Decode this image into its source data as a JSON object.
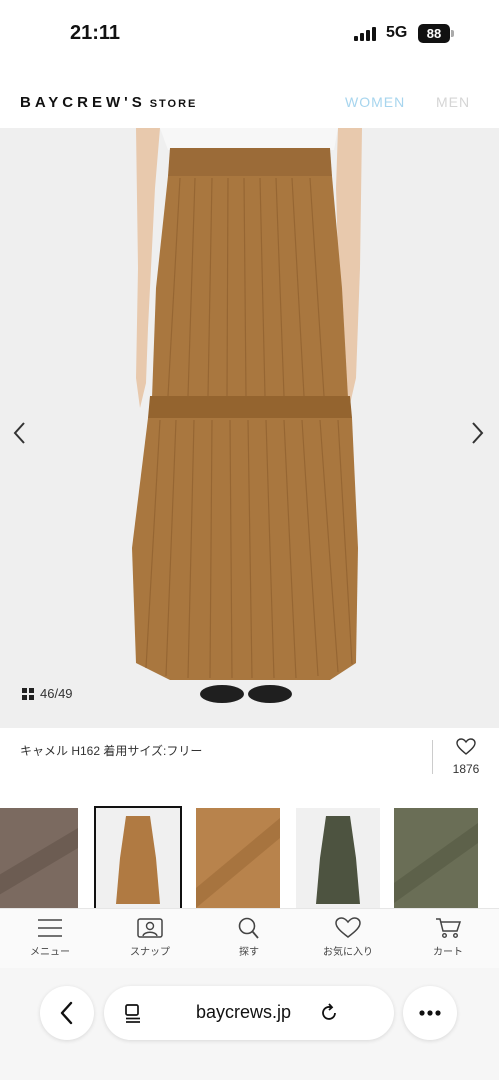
{
  "status_bar": {
    "time": "21:11",
    "network": "5G",
    "battery": "88"
  },
  "header": {
    "logo_main": "BAYCREW'S",
    "logo_sub": "STORE",
    "nav_women": "WOMEN",
    "nav_men": "MEN"
  },
  "gallery": {
    "counter": "46/49",
    "caption": "キャメル H162 着用サイズ:フリー",
    "favorite_count": "1876"
  },
  "thumbnails": [
    {
      "label": "brown fabric swatch",
      "color": "#7b6a60"
    },
    {
      "label": "camel skirt on model",
      "color": "#b07a42",
      "selected": true
    },
    {
      "label": "camel fabric swatch",
      "color": "#b8834c"
    },
    {
      "label": "olive skirt on model",
      "color": "#4d5340"
    },
    {
      "label": "olive fabric swatch",
      "color": "#6a6e56"
    }
  ],
  "bottom_nav": [
    {
      "label": "メニュー",
      "icon": "menu-icon"
    },
    {
      "label": "スナップ",
      "icon": "snap-icon"
    },
    {
      "label": "探す",
      "icon": "search-icon"
    },
    {
      "label": "お気に入り",
      "icon": "heart-icon"
    },
    {
      "label": "カート",
      "icon": "cart-icon"
    }
  ],
  "browser": {
    "url": "baycrews.jp"
  },
  "colors": {
    "accent_women": "#a7d5ee",
    "skirt": "#a9773f",
    "background": "#efefef"
  }
}
